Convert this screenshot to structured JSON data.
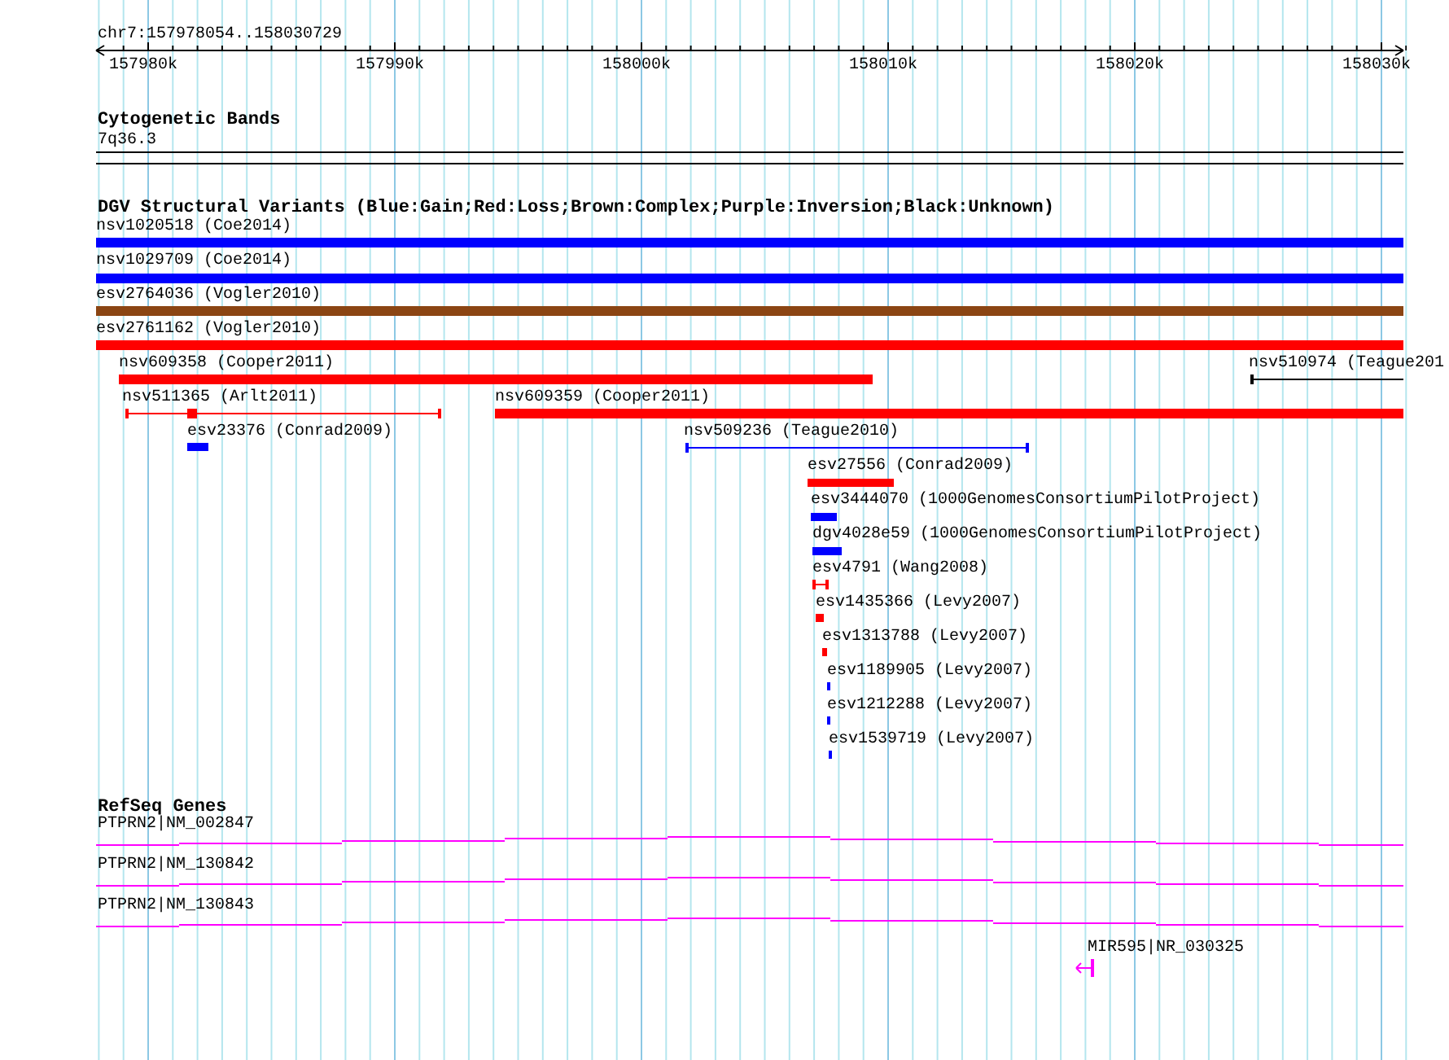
{
  "ruler": {
    "location": "chr7:157978054..158030729",
    "ticks": [
      "157980k",
      "157990k",
      "158000k",
      "158010k",
      "158020k",
      "158030k"
    ]
  },
  "tracks": [
    {
      "title": "Cytogenetic Bands",
      "kind": "bands",
      "features": [
        {
          "label": "7q36.3",
          "kind": "band"
        }
      ]
    },
    {
      "title": "DGV Structural Variants (Blue:Gain;Red:Loss;Brown:Complex;Purple:Inversion;Black:Unknown)",
      "kind": "variants",
      "features": [
        {
          "label": "nsv1020518 (Coe2014)",
          "kind": "bar",
          "color": "#0000ff"
        },
        {
          "label": "nsv1029709 (Coe2014)",
          "kind": "bar",
          "color": "#0000ff"
        },
        {
          "label": "esv2764036 (Vogler2010)",
          "kind": "bar",
          "color": "#8b4513"
        },
        {
          "label": "esv2761162 (Vogler2010)",
          "kind": "bar",
          "color": "#ff0000"
        },
        {
          "label": "nsv609358 (Cooper2011)",
          "kind": "bar",
          "color": "#ff0000"
        },
        {
          "label": "nsv510974 (Teague201",
          "kind": "range",
          "color": "#000000"
        },
        {
          "label": "nsv511365 (Arlt2011)",
          "kind": "range",
          "color": "#ff0000"
        },
        {
          "label": "nsv609359 (Cooper2011)",
          "kind": "bar",
          "color": "#ff0000"
        },
        {
          "label": "esv23376 (Conrad2009)",
          "kind": "bar",
          "color": "#0000ff"
        },
        {
          "label": "nsv509236 (Teague2010)",
          "kind": "range",
          "color": "#0000ff"
        },
        {
          "label": "esv27556 (Conrad2009)",
          "kind": "bar",
          "color": "#ff0000"
        },
        {
          "label": "esv3444070 (1000GenomesConsortiumPilotProject)",
          "kind": "bar",
          "color": "#0000ff"
        },
        {
          "label": "dgv4028e59 (1000GenomesConsortiumPilotProject)",
          "kind": "bar",
          "color": "#0000ff"
        },
        {
          "label": "esv4791 (Wang2008)",
          "kind": "range",
          "color": "#ff0000"
        },
        {
          "label": "esv1435366 (Levy2007)",
          "kind": "bar",
          "color": "#ff0000"
        },
        {
          "label": "esv1313788 (Levy2007)",
          "kind": "bar",
          "color": "#ff0000"
        },
        {
          "label": "esv1189905 (Levy2007)",
          "kind": "bar",
          "color": "#0000ff"
        },
        {
          "label": "esv1212288 (Levy2007)",
          "kind": "bar",
          "color": "#0000ff"
        },
        {
          "label": "esv1539719 (Levy2007)",
          "kind": "bar",
          "color": "#0000ff"
        }
      ]
    },
    {
      "title": "RefSeq Genes",
      "kind": "genes",
      "features": [
        {
          "label": "PTPRN2|NM_002847",
          "kind": "transcript"
        },
        {
          "label": "PTPRN2|NM_130842",
          "kind": "transcript"
        },
        {
          "label": "PTPRN2|NM_130843",
          "kind": "transcript"
        },
        {
          "label": "MIR595|NR_030325",
          "kind": "arrow"
        }
      ]
    }
  ]
}
